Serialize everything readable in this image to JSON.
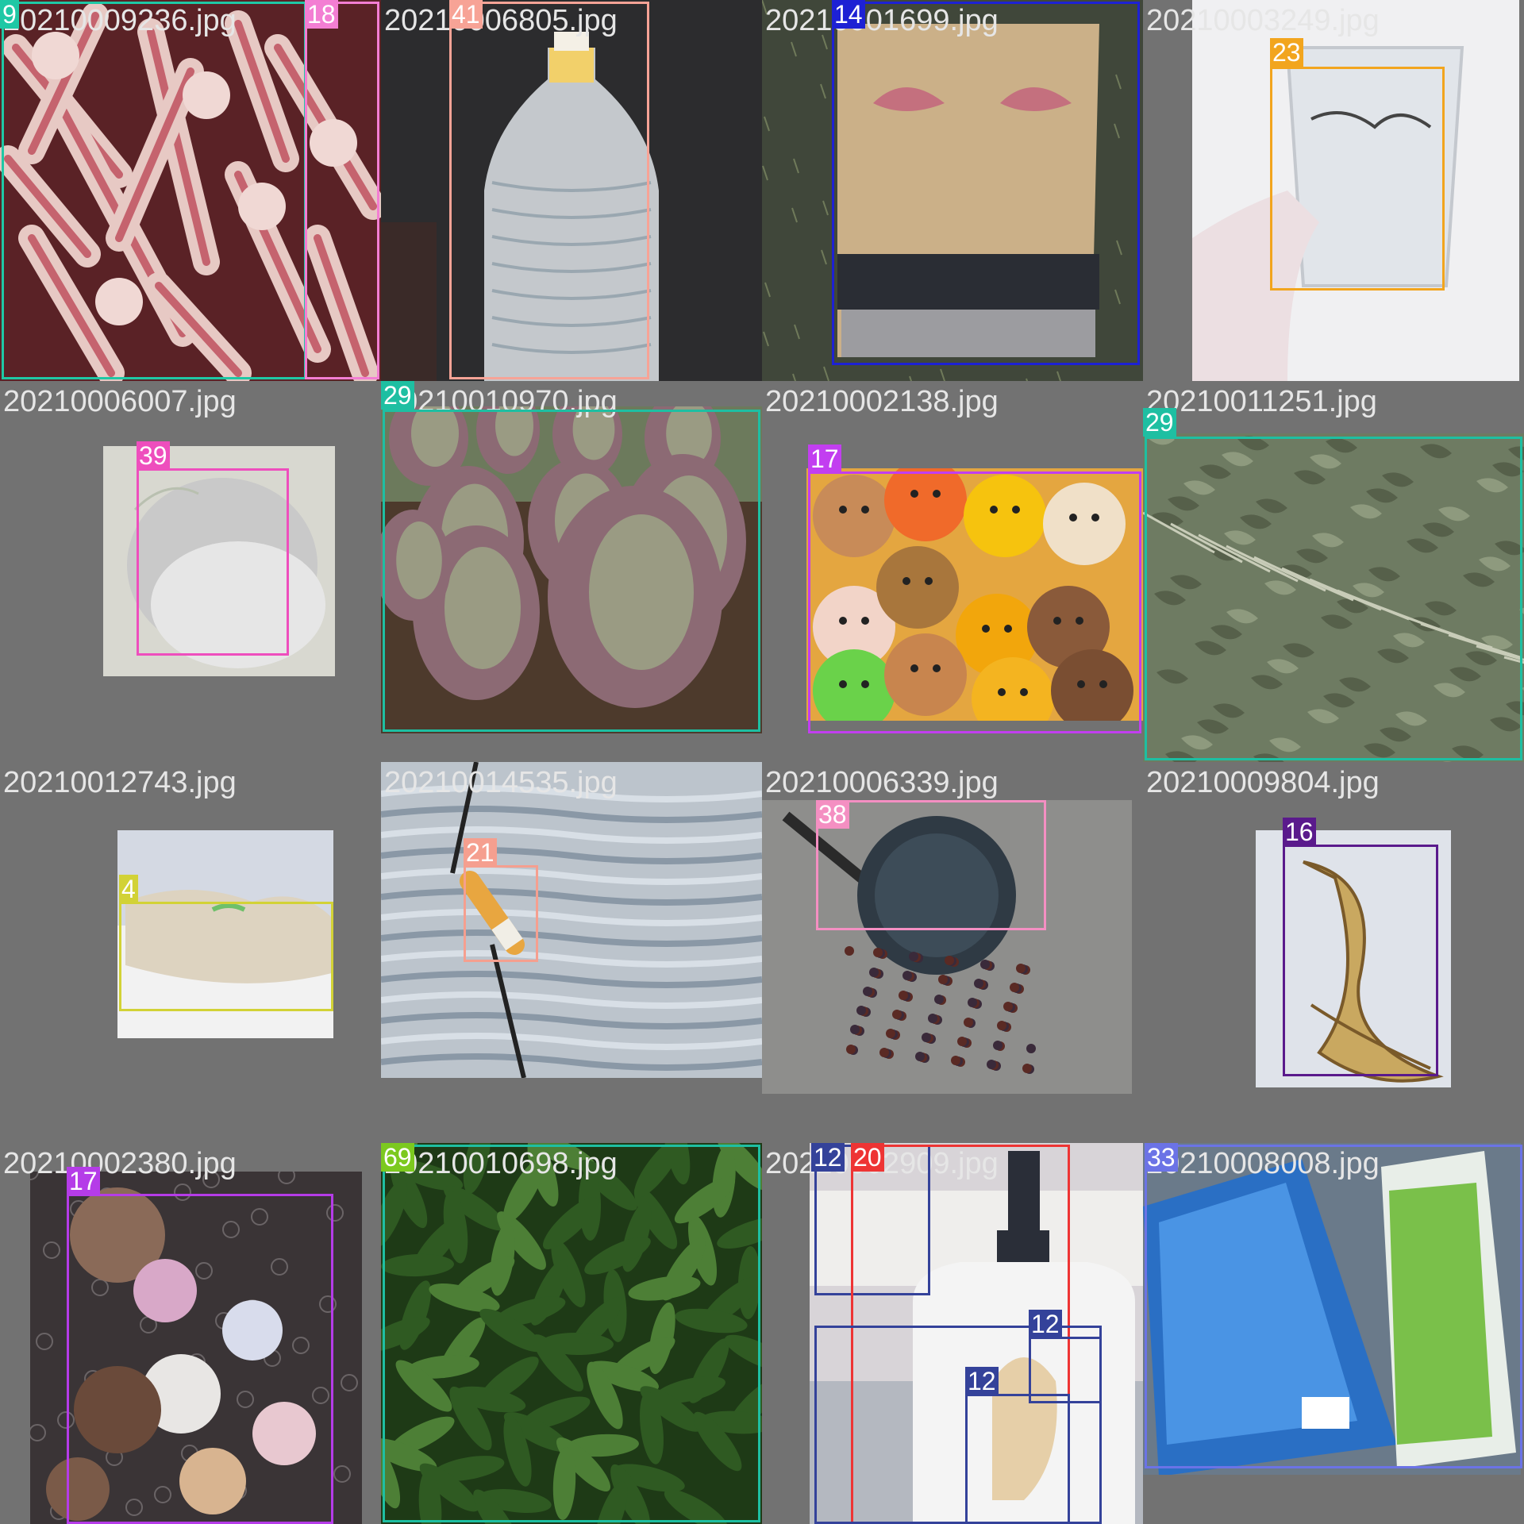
{
  "tiles": [
    {
      "file": "20210009236.jpg",
      "photo": "meat-bones",
      "boxes": [
        {
          "label": "9",
          "color": "#1fc8a5"
        },
        {
          "label": "18",
          "color": "#f37ed3"
        }
      ]
    },
    {
      "file": "20210006805.jpg",
      "photo": "plastic-water-bottle",
      "boxes": [
        {
          "label": "41",
          "color": "#f7a396"
        }
      ]
    },
    {
      "file": "20210001699.jpg",
      "photo": "redbull-can",
      "boxes": [
        {
          "label": "14",
          "color": "#1d21d4"
        }
      ]
    },
    {
      "file": "20210003249.jpg",
      "photo": "glass-cup",
      "boxes": [
        {
          "label": "23",
          "color": "#f2a51e"
        }
      ]
    },
    {
      "file": "20210006007.jpg",
      "photo": "ceramic-bowl",
      "boxes": [
        {
          "label": "39",
          "color": "#ee4ebd"
        }
      ]
    },
    {
      "file": "20210010970.jpg",
      "photo": "cabbage-field",
      "boxes": [
        {
          "label": "29",
          "color": "#1ebfa2"
        }
      ]
    },
    {
      "file": "20210002138.jpg",
      "photo": "plush-toys",
      "boxes": [
        {
          "label": "17",
          "color": "#c23ef0"
        }
      ]
    },
    {
      "file": "20210011251.jpg",
      "photo": "wilted-greens",
      "boxes": [
        {
          "label": "29",
          "color": "#1ebfa2"
        }
      ]
    },
    {
      "file": "20210012743.jpg",
      "photo": "cloth-towel",
      "boxes": [
        {
          "label": "4",
          "color": "#d2d236"
        }
      ]
    },
    {
      "file": "20210014535.jpg",
      "photo": "cigarette-butt",
      "boxes": [
        {
          "label": "21",
          "color": "#f59f8f"
        }
      ]
    },
    {
      "file": "20210006339.jpg",
      "photo": "frying-pan",
      "boxes": [
        {
          "label": "38",
          "color": "#f48fc2"
        }
      ]
    },
    {
      "file": "20210009804.jpg",
      "photo": "banana-peel",
      "boxes": [
        {
          "label": "16",
          "color": "#5a1a8c"
        }
      ]
    },
    {
      "file": "20210002380.jpg",
      "photo": "stuffed-animals",
      "boxes": [
        {
          "label": "17",
          "color": "#b53ce8"
        }
      ]
    },
    {
      "file": "20210010698.jpg",
      "photo": "leafy-vegetables",
      "boxes": [
        {
          "label": "69",
          "color": "#7cc91f"
        },
        {
          "label": "",
          "color": "#1ebfa2"
        }
      ]
    },
    {
      "file": "20210002909.jpg",
      "photo": "lotion-bottle",
      "boxes": [
        {
          "label": "12",
          "color": "#34429a"
        },
        {
          "label": "20",
          "color": "#ee3434"
        },
        {
          "label": "12",
          "color": "#34429a"
        },
        {
          "label": "12",
          "color": "#34429a"
        },
        {
          "label": "",
          "color": "#34429a"
        }
      ]
    },
    {
      "file": "20210008008.jpg",
      "photo": "medicine-boxes",
      "boxes": [
        {
          "label": "33",
          "color": "#6b73e6"
        }
      ]
    }
  ]
}
